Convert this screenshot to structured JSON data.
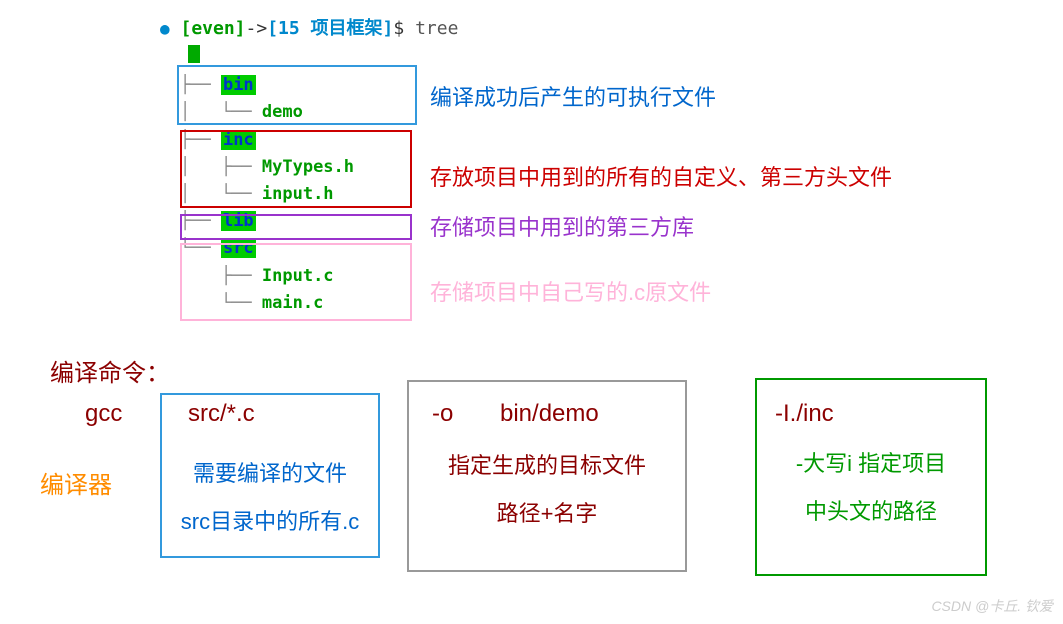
{
  "terminal": {
    "prompt_even": "[even]",
    "prompt_arrow": "->",
    "prompt_path": "[15 项目框架]",
    "prompt_dollar": "$",
    "command": "tree"
  },
  "tree": {
    "dirs": {
      "bin": "bin",
      "inc": "inc",
      "lib": "lib",
      "src": "src"
    },
    "files": {
      "demo": "demo",
      "mytypes": "MyTypes.h",
      "input_h": "input.h",
      "input_c": "Input.c",
      "main_c": "main.c"
    }
  },
  "labels": {
    "bin": "编译成功后产生的可执行文件",
    "inc": "存放项目中用到的所有的自定义、第三方头文件",
    "lib": "存储项目中用到的第三方库",
    "src": "存储项目中自己写的.c原文件"
  },
  "compile": {
    "title": "编译命令：",
    "gcc": "gcc",
    "src": "src/*.c",
    "o_flag": "-o",
    "bin_demo": "bin/demo",
    "i_flag": "-I./inc",
    "compiler_label": "编译器"
  },
  "explanations": {
    "box1_line1": "需要编译的文件",
    "box1_line2": "src目录中的所有.c",
    "box2_line1": "指定生成的目标文件",
    "box2_line2": "路径+名字",
    "box3_line1": "-大写i  指定项目",
    "box3_line2": "中头文的路径"
  },
  "watermark": "CSDN @卡丘. 钦爱"
}
